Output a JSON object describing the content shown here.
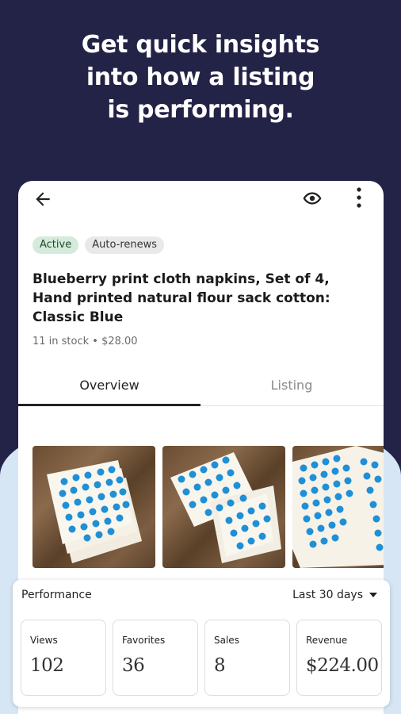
{
  "promo": {
    "headline_lines": [
      "Get quick insights",
      "into how a listing",
      "is performing."
    ]
  },
  "toolbar": {
    "back_icon": "arrow-left-icon",
    "preview_icon": "eye-icon",
    "more_icon": "more-vertical-icon"
  },
  "listing": {
    "badges": [
      "Active",
      "Auto-renews"
    ],
    "title": "Blueberry print cloth napkins, Set of 4, Hand printed natural flour sack cotton: Classic Blue",
    "meta": "11 in stock • $28.00"
  },
  "tabs": [
    {
      "label": "Overview",
      "selected": true
    },
    {
      "label": "Listing",
      "selected": false
    }
  ],
  "performance": {
    "title": "Performance",
    "range": "Last 30 days",
    "stats": [
      {
        "label": "Views",
        "value": "102"
      },
      {
        "label": "Favorites",
        "value": "36"
      },
      {
        "label": "Sales",
        "value": "8"
      },
      {
        "label": "Revenue",
        "value": "$224.00"
      }
    ]
  },
  "colors": {
    "background": "#232347",
    "lower_background": "#d6e6f5",
    "dot_blue": "#1f8fd6",
    "active_badge": "#d4ebdb"
  }
}
